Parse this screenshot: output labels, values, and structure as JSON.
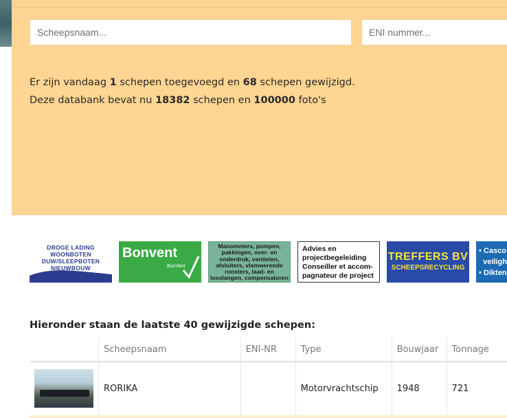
{
  "search": {
    "name_placeholder": "Scheepsnaam...",
    "eni_placeholder": "ENI nummer..."
  },
  "stats": {
    "line1_prefix": "Er zijn vandaag ",
    "added": "1",
    "line1_mid": " schepen toegevoegd en ",
    "changed": "68",
    "line1_suffix": " schepen gewijzigd.",
    "line2_prefix": "Deze databank bevat nu ",
    "ships": "18382",
    "line2_mid": " schepen en ",
    "photos": "100000",
    "line2_suffix": " foto's"
  },
  "banners": {
    "b1": "DROGE LADING\nWOONBOTEN\nDUW/SLEEPBOTEN\nNIEUWBOUW\nTANKERS",
    "b2_title": "Bonvent",
    "b2_sub": "BonVent",
    "b3": "Manometers, pompen, pakkingen, over- en onderdruk, ventielen, afsluiters, vlamwerende roosters, laad- en losslangen, compensatoren",
    "b4": "Advies en projectbegeleiding Conseiller et accom-pagnateur de project",
    "b5_title": "TREFFERS BV",
    "b5_sub": "SCHEEPSRECYCLING",
    "b6": "• Casco\n  veiligh\n• Dikten"
  },
  "list": {
    "heading": "Hieronder staan de laatste 40 gewijzigde schepen:",
    "columns": [
      "",
      "Scheepsnaam",
      "ENI-NR",
      "Type",
      "Bouwjaar",
      "Tonnage"
    ],
    "rows": [
      {
        "name": "RORIKA",
        "eni": "",
        "type": "Motorvrachtschip",
        "year": "1948",
        "tonnage": "721"
      }
    ]
  }
}
